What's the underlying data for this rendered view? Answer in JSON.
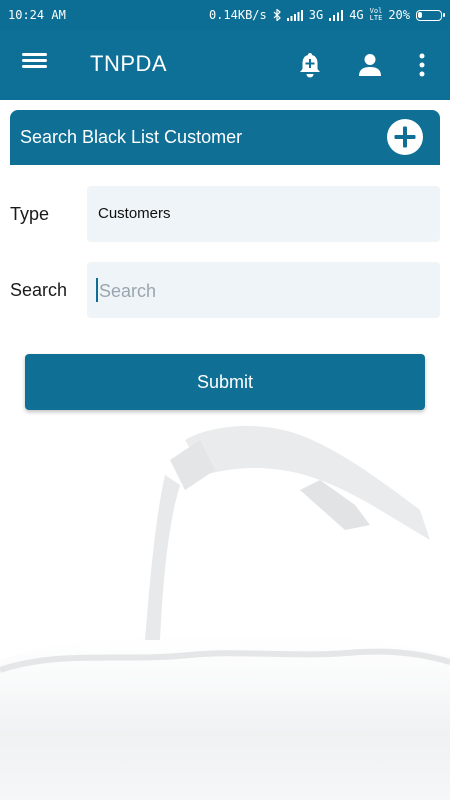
{
  "status_bar": {
    "time": "10:24 AM",
    "net_speed": "0.14KB/s",
    "net_3g": "3G",
    "net_4g": "4G",
    "volte_top": "Vol",
    "volte_bottom": "LTE",
    "battery_text": "20%",
    "battery_level": 0.2
  },
  "app_bar": {
    "title": "TNPDA",
    "menu_icon": "hamburger-menu-icon",
    "notification_icon": "bell-plus-icon",
    "profile_icon": "person-icon",
    "more_icon": "more-vertical-icon"
  },
  "panel": {
    "title": "Search Black List Customer",
    "add_icon": "plus-icon"
  },
  "form": {
    "type_label": "Type",
    "type_value": "Customers",
    "search_label": "Search",
    "search_placeholder": "Search",
    "search_value": ""
  },
  "submit_label": "Submit",
  "colors": {
    "primary": "#0e7096",
    "field_background": "#eef4f8",
    "background": "#ffffff"
  }
}
